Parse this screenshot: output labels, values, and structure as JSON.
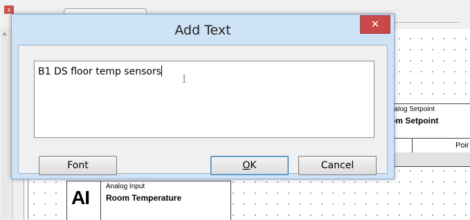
{
  "background_app": {
    "close_glyph": "x",
    "collapse_glyph": "^",
    "setpoint_block": {
      "type_label": "nalog Setpoint",
      "name_label": "om Setpoint",
      "column_label": "Poir"
    },
    "ai_block": {
      "letters": "AI",
      "type_label": "Analog Input",
      "name_label": "Room Temperature"
    }
  },
  "dialog": {
    "title": "Add Text",
    "close_glyph": "✕",
    "text_value": "B1 DS floor temp sensors",
    "buttons": {
      "font_label": "Font",
      "ok_label_first": "O",
      "ok_label_rest": "K",
      "cancel_label": "Cancel"
    }
  },
  "colors": {
    "dialog_frame": "#cfe3f7",
    "close_button": "#c9484a",
    "canvas": "#ffffff"
  }
}
